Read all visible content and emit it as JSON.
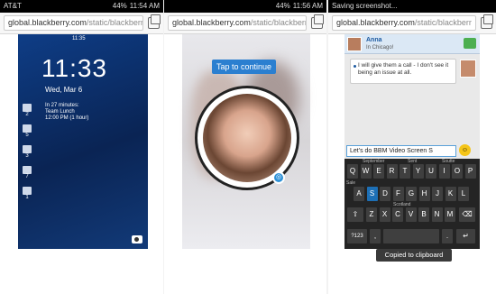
{
  "panels": [
    {
      "status": {
        "left": "AT&T",
        "right": [
          "44%",
          "11:54 AM"
        ]
      },
      "url": {
        "domain": "global.blackberry.com",
        "path": "/static/blackberr"
      },
      "phone": {
        "status_time": "11:35",
        "clock": "11:33",
        "date": "Wed, Mar 6",
        "event_lines": [
          "In 27 minutes:",
          "Team Lunch",
          "12:00 PM (1 hour)"
        ],
        "notif_counts": [
          "2",
          "5",
          "3",
          "7",
          "1"
        ]
      }
    },
    {
      "status": {
        "left": "",
        "right": [
          "44%",
          "11:56 AM"
        ]
      },
      "url": {
        "domain": "global.blackberry.com",
        "path": "/static/blackberr"
      },
      "tap_label": "Tap to continue"
    },
    {
      "status": {
        "left": "Saving screenshot...",
        "right": []
      },
      "url": {
        "domain": "global.blackberry.com",
        "path": "/static/blackberr"
      },
      "contact": {
        "name": "Anna",
        "status": "In Chicago!"
      },
      "message": "I will give them a call - I don't see it being an issue at all.",
      "composer_text": "Let's do BBM Video Screen S",
      "keyboard": {
        "row1": [
          "Q",
          "W",
          "E",
          "R",
          "T",
          "Y",
          "U",
          "I",
          "O",
          "P"
        ],
        "row2": [
          "A",
          "S",
          "D",
          "F",
          "G",
          "H",
          "J",
          "K",
          "L"
        ],
        "row3": [
          "Z",
          "X",
          "C",
          "V",
          "B",
          "N",
          "M"
        ],
        "hints": [
          "September",
          "Sent",
          "Soutte",
          "Sale",
          "Scotland"
        ],
        "symbols_label": "?123",
        "highlight": "S"
      },
      "toast": "Copied to clipboard"
    }
  ]
}
